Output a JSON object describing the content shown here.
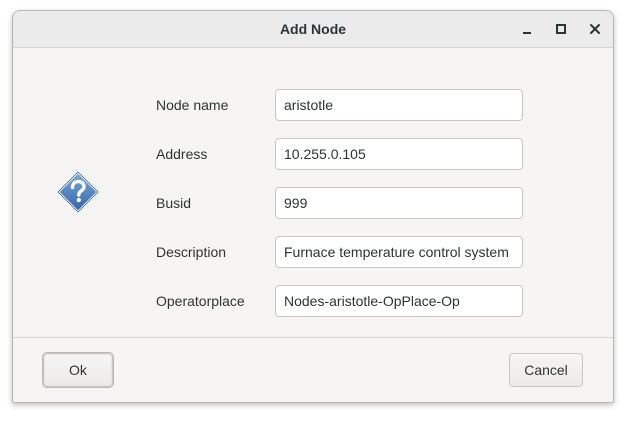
{
  "window": {
    "title": "Add Node"
  },
  "form": {
    "fields": [
      {
        "label": "Node name",
        "value": "aristotle"
      },
      {
        "label": "Address",
        "value": "10.255.0.105"
      },
      {
        "label": "Busid",
        "value": "999"
      },
      {
        "label": "Description",
        "value": "Furnace temperature control system"
      },
      {
        "label": "Operatorplace",
        "value": "Nodes-aristotle-OpPlace-Op"
      }
    ]
  },
  "buttons": {
    "ok_label": "Ok",
    "cancel_label": "Cancel"
  },
  "icons": {
    "dialog_icon": "question-icon",
    "accent_color": "#3d74b8"
  }
}
